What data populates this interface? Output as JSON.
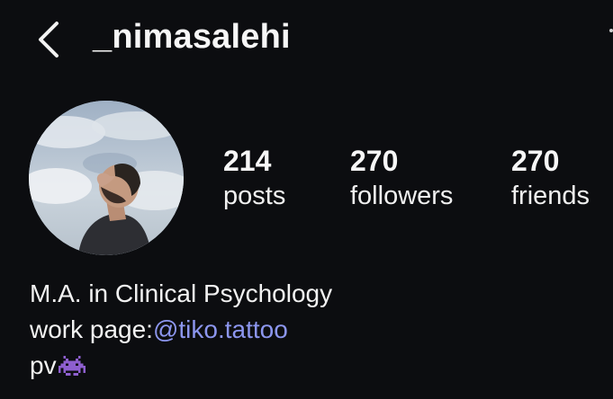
{
  "header": {
    "username": "_nimasalehi",
    "back_icon": "chevron-left-icon",
    "more_icon": "more-vertical-icon"
  },
  "profile": {
    "avatar": "profile-photo"
  },
  "stats": {
    "posts": {
      "count": "214",
      "label": "posts"
    },
    "followers": {
      "count": "270",
      "label": "followers"
    },
    "friends": {
      "count": "270",
      "label": "friends"
    }
  },
  "bio": {
    "line1": "M.A. in Clinical Psychology",
    "line2_prefix": "work page:",
    "line2_link": "@tiko.tattoo",
    "line3_text": "pv",
    "line3_emoji": "alien-monster-icon"
  },
  "colors": {
    "background": "#0c0d10",
    "text": "#f5f5f5",
    "link": "#8c96ee",
    "emoji": "#8e5fcf"
  }
}
